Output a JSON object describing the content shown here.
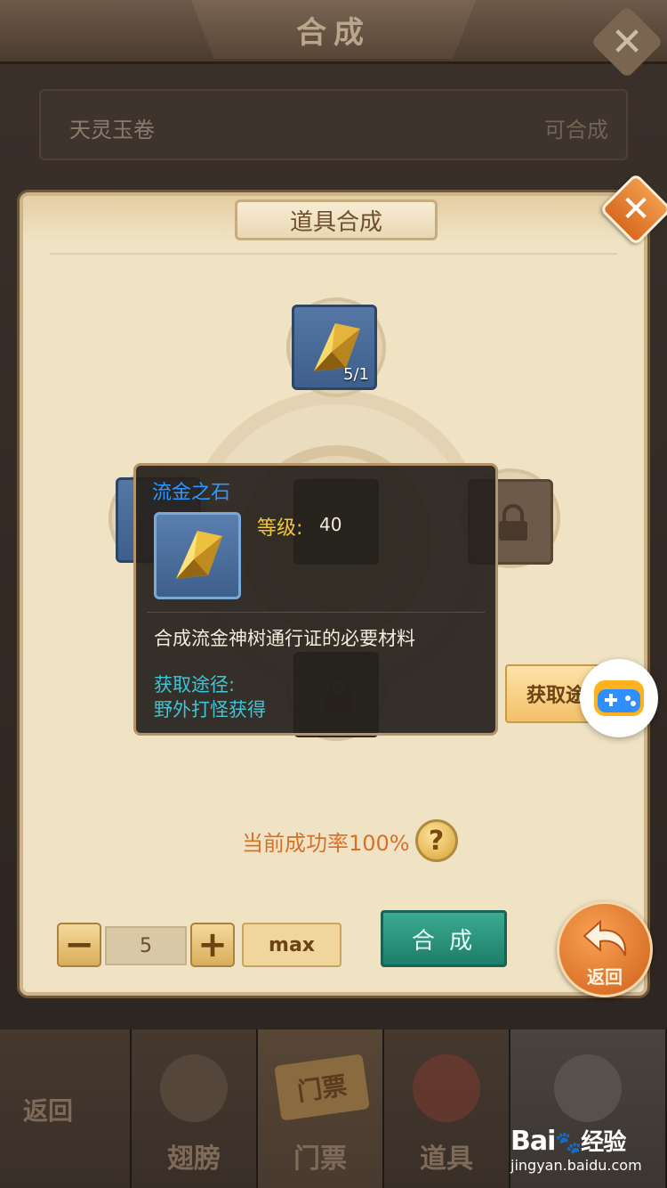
{
  "background": {
    "title": "合成",
    "close_icon": "close-icon",
    "row": {
      "name": "天灵玉卷",
      "status": "可合成"
    },
    "bottom_tabs": [
      {
        "label": "返回"
      },
      {
        "label": "翅膀"
      },
      {
        "label": "门票",
        "emblem_text": "门票"
      },
      {
        "label": "道具"
      },
      {
        "label": ""
      }
    ]
  },
  "dialog": {
    "title": "道具合成",
    "target_item": {
      "count": "5/1",
      "icon": "gold-crystal-icon"
    },
    "success_rate": "当前成功率100%",
    "help_icon": "?",
    "quantity": {
      "minus": "−",
      "value": "5",
      "plus": "+",
      "max": "max"
    },
    "combine_label": "合 成",
    "back_label": "返回",
    "get_button_label": "获取途径"
  },
  "tooltip": {
    "name": "流金之石",
    "level_label": "等级:",
    "level_value": "40",
    "description": "合成流金神树通行证的必要材料",
    "source_label": "获取途径:",
    "source_value": "野外打怪获得"
  },
  "watermark": {
    "logo": "Bai",
    "logo_suffix": "经验",
    "url": "jingyan.baidu.com"
  },
  "colors": {
    "accent_orange": "#d8702a",
    "tooltip_name": "#2f97ff",
    "tooltip_level": "#f2c53a",
    "tooltip_source": "#3fc4d8",
    "combine_button": "#2a9580",
    "dialog_bg": "#efe3c4"
  }
}
